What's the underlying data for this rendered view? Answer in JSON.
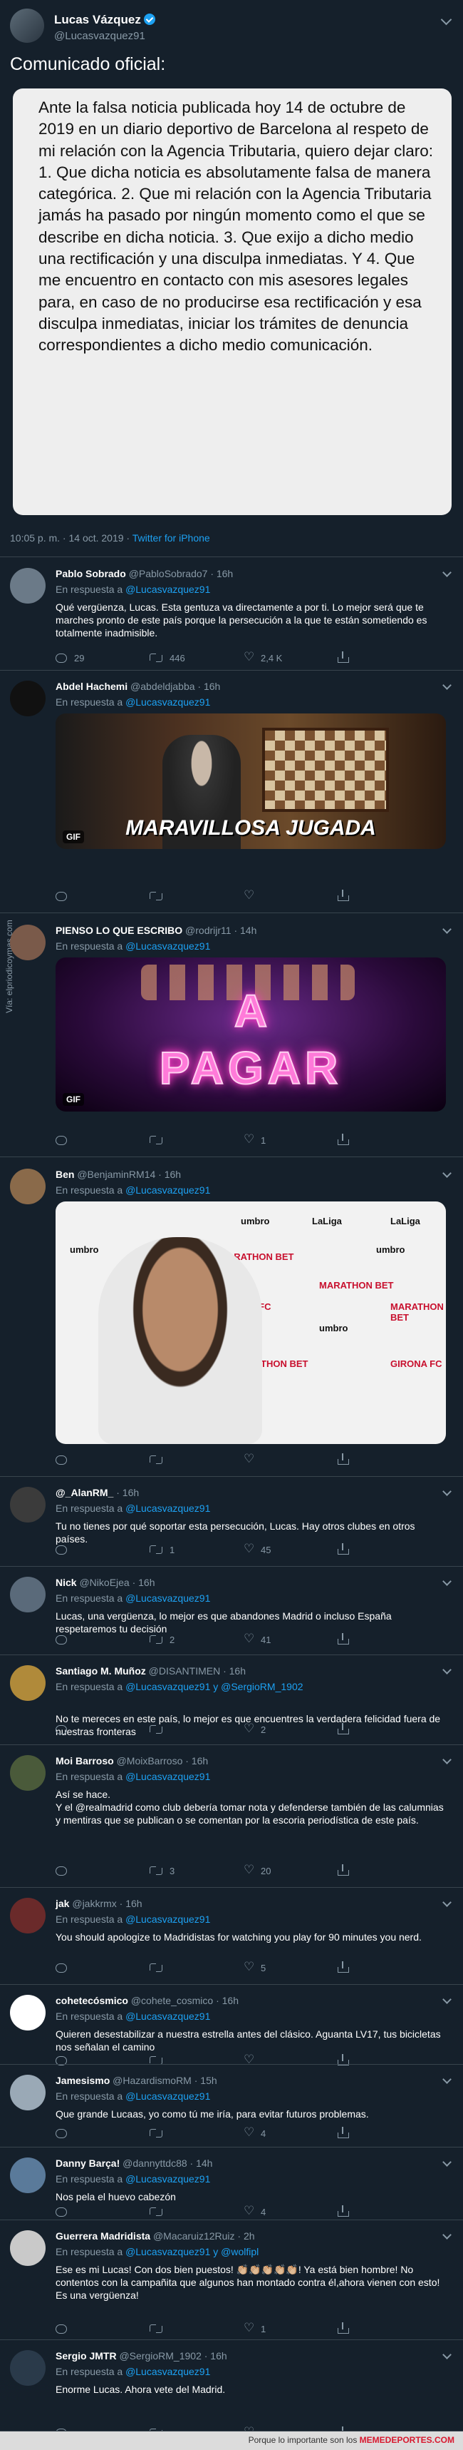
{
  "main_tweet": {
    "name": "Lucas Vázquez",
    "handle": "@Lucasvazquez91",
    "text": "Comunicado oficial:",
    "statement": "Ante la falsa noticia publicada hoy 14 de octubre de 2019 en un diario deportivo de Barcelona al respeto de mi relación con la Agencia Tributaria, quiero dejar claro: 1. Que dicha noticia es absolutamente falsa de manera categórica. 2. Que mi relación con la Agencia Tributaria jamás ha pasado por ningún momento como el que se describe en dicha noticia. 3. Que exijo a dicho medio una rectificación y una disculpa inmediatas. Y 4. Que me encuentro en contacto con mis asesores legales para, en caso de no producirse esa rectificación y esa disculpa inmediatas, iniciar los trámites de denuncia correspondientes a dicho medio comunicación.",
    "time": "10:05 p. m. · 14 oct. 2019 ·",
    "source": "Twitter for iPhone"
  },
  "in_reply_label": "En respuesta a",
  "replies": [
    {
      "name": "Pablo Sobrado",
      "handle": "@PabloSobrado7 · 16h",
      "mention": "@Lucasvazquez91",
      "text": "Qué vergüenza, Lucas. Esta gentuza va directamente a por ti. Lo mejor será que te marches pronto de este país porque la persecución a la que te están sometiendo es totalmente inadmisible.",
      "replies": "29",
      "retweets": "446",
      "likes": "2,4 K"
    },
    {
      "name": "Abdel Hachemi",
      "handle": "@abdeldjabba · 16h",
      "mention": "@Lucasvazquez91",
      "media_caption": "MARAVILLOSA JUGADA",
      "gif": "GIF",
      "replies": "",
      "retweets": "",
      "likes": ""
    },
    {
      "name": "PIENSO LO QUE ESCRIBO",
      "handle": "@rodrijr11 · 14h",
      "mention": "@Lucasvazquez91",
      "media_caption": "A PAGAR",
      "gif": "GIF",
      "replies": "",
      "retweets": "",
      "likes": "1"
    },
    {
      "name": "Ben",
      "handle": "@BenjaminRM14 · 16h",
      "mention": "@Lucasvazquez91",
      "sponsors": [
        "MARATHON BET",
        "umbro",
        "LaLiga",
        "GIRONA FC"
      ],
      "replies": "",
      "retweets": "",
      "likes": ""
    },
    {
      "name": "@_AlanRM_",
      "handle": "· 16h",
      "mention": "@Lucasvazquez91",
      "text": "Tu no tienes por qué soportar esta persecución, Lucas. Hay otros clubes en otros países.",
      "replies": "",
      "retweets": "1",
      "likes": "45"
    },
    {
      "name": "Nick",
      "handle": "@NikoEjea · 16h",
      "mention": "@Lucasvazquez91",
      "text": "Lucas, una  vergüenza, lo mejor es que abandones Madrid o incluso España respetaremos tu decisión",
      "replies": "",
      "retweets": "2",
      "likes": "41"
    },
    {
      "name": "Santiago M. Muñoz",
      "handle": "@DISANTIMEN · 16h",
      "mention": "@Lucasvazquez91 y @SergioRM_1902",
      "text": "No te mereces en este país, lo mejor es que encuentres la verdadera felicidad fuera de nuestras fronteras",
      "replies": "",
      "retweets": "",
      "likes": "2"
    },
    {
      "name": "Moi Barroso",
      "handle": "@MoixBarroso · 16h",
      "mention": "@Lucasvazquez91",
      "text_lines": [
        "Así se hace.",
        "Y el @realmadrid como club debería tomar nota y defenderse también de las calumnias y mentiras que se publican o se comentan por la escoria periodística de este país."
      ],
      "replies": "",
      "retweets": "3",
      "likes": "20"
    },
    {
      "name": "jak",
      "handle": "@jakkrmx · 16h",
      "mention": "@Lucasvazquez91",
      "text": "You should apologize to Madridistas for watching you play for 90 minutes you nerd.",
      "replies": "",
      "retweets": "",
      "likes": "5"
    },
    {
      "name": "cohetecósmico",
      "handle": "@cohete_cosmico · 16h",
      "mention": "@Lucasvazquez91",
      "text": "Quieren desestabilizar a nuestra estrella antes del clásico. Aguanta LV17, tus bicicletas nos señalan el camino",
      "replies": "",
      "retweets": "",
      "likes": ""
    },
    {
      "name": "Jamesismo",
      "handle": "@HazardismoRM · 15h",
      "mention": "@Lucasvazquez91",
      "text": "Que grande Lucaas, yo como tú me iría, para evitar futuros problemas.",
      "replies": "",
      "retweets": "",
      "likes": "4"
    },
    {
      "name": "Danny Barça!",
      "handle": "@dannyttdc88 · 14h",
      "mention": "@Lucasvazquez91",
      "text": "Nos pela el huevo cabezón",
      "replies": "",
      "retweets": "",
      "likes": "4"
    },
    {
      "name": "Guerrera Madridista",
      "handle": "@Macaruiz12Ruiz · 2h",
      "mention": "@Lucasvazquez91 y @wolfipl",
      "text": "Ese es mi Lucas! Con dos bien puestos! 👏🏼👏🏼👏🏼👏🏼👏🏼! Ya está bien hombre! No contentos con la campañita que algunos han montado contra él,ahora vienen con esto! Es una vergüenza!",
      "replies": "",
      "retweets": "",
      "likes": "1"
    },
    {
      "name": "Sergio JMTR",
      "handle": "@SergioRM_1902 · 16h",
      "mention": "@Lucasvazquez91",
      "text": "Enorme Lucas. Ahora vete del Madrid.",
      "replies": "",
      "retweets": "",
      "likes": ""
    }
  ],
  "watermark": "Vía: elpriodicoymas.com",
  "footer": {
    "prefix": "Porque lo importante son los ",
    "brand": "MEMEDEPORTES.COM",
    "colors": {
      "brand": "#d8192f"
    }
  },
  "colors": {
    "background": "#15202b",
    "link": "#1da1f2",
    "muted": "#8899a6",
    "divider": "#38444d"
  }
}
